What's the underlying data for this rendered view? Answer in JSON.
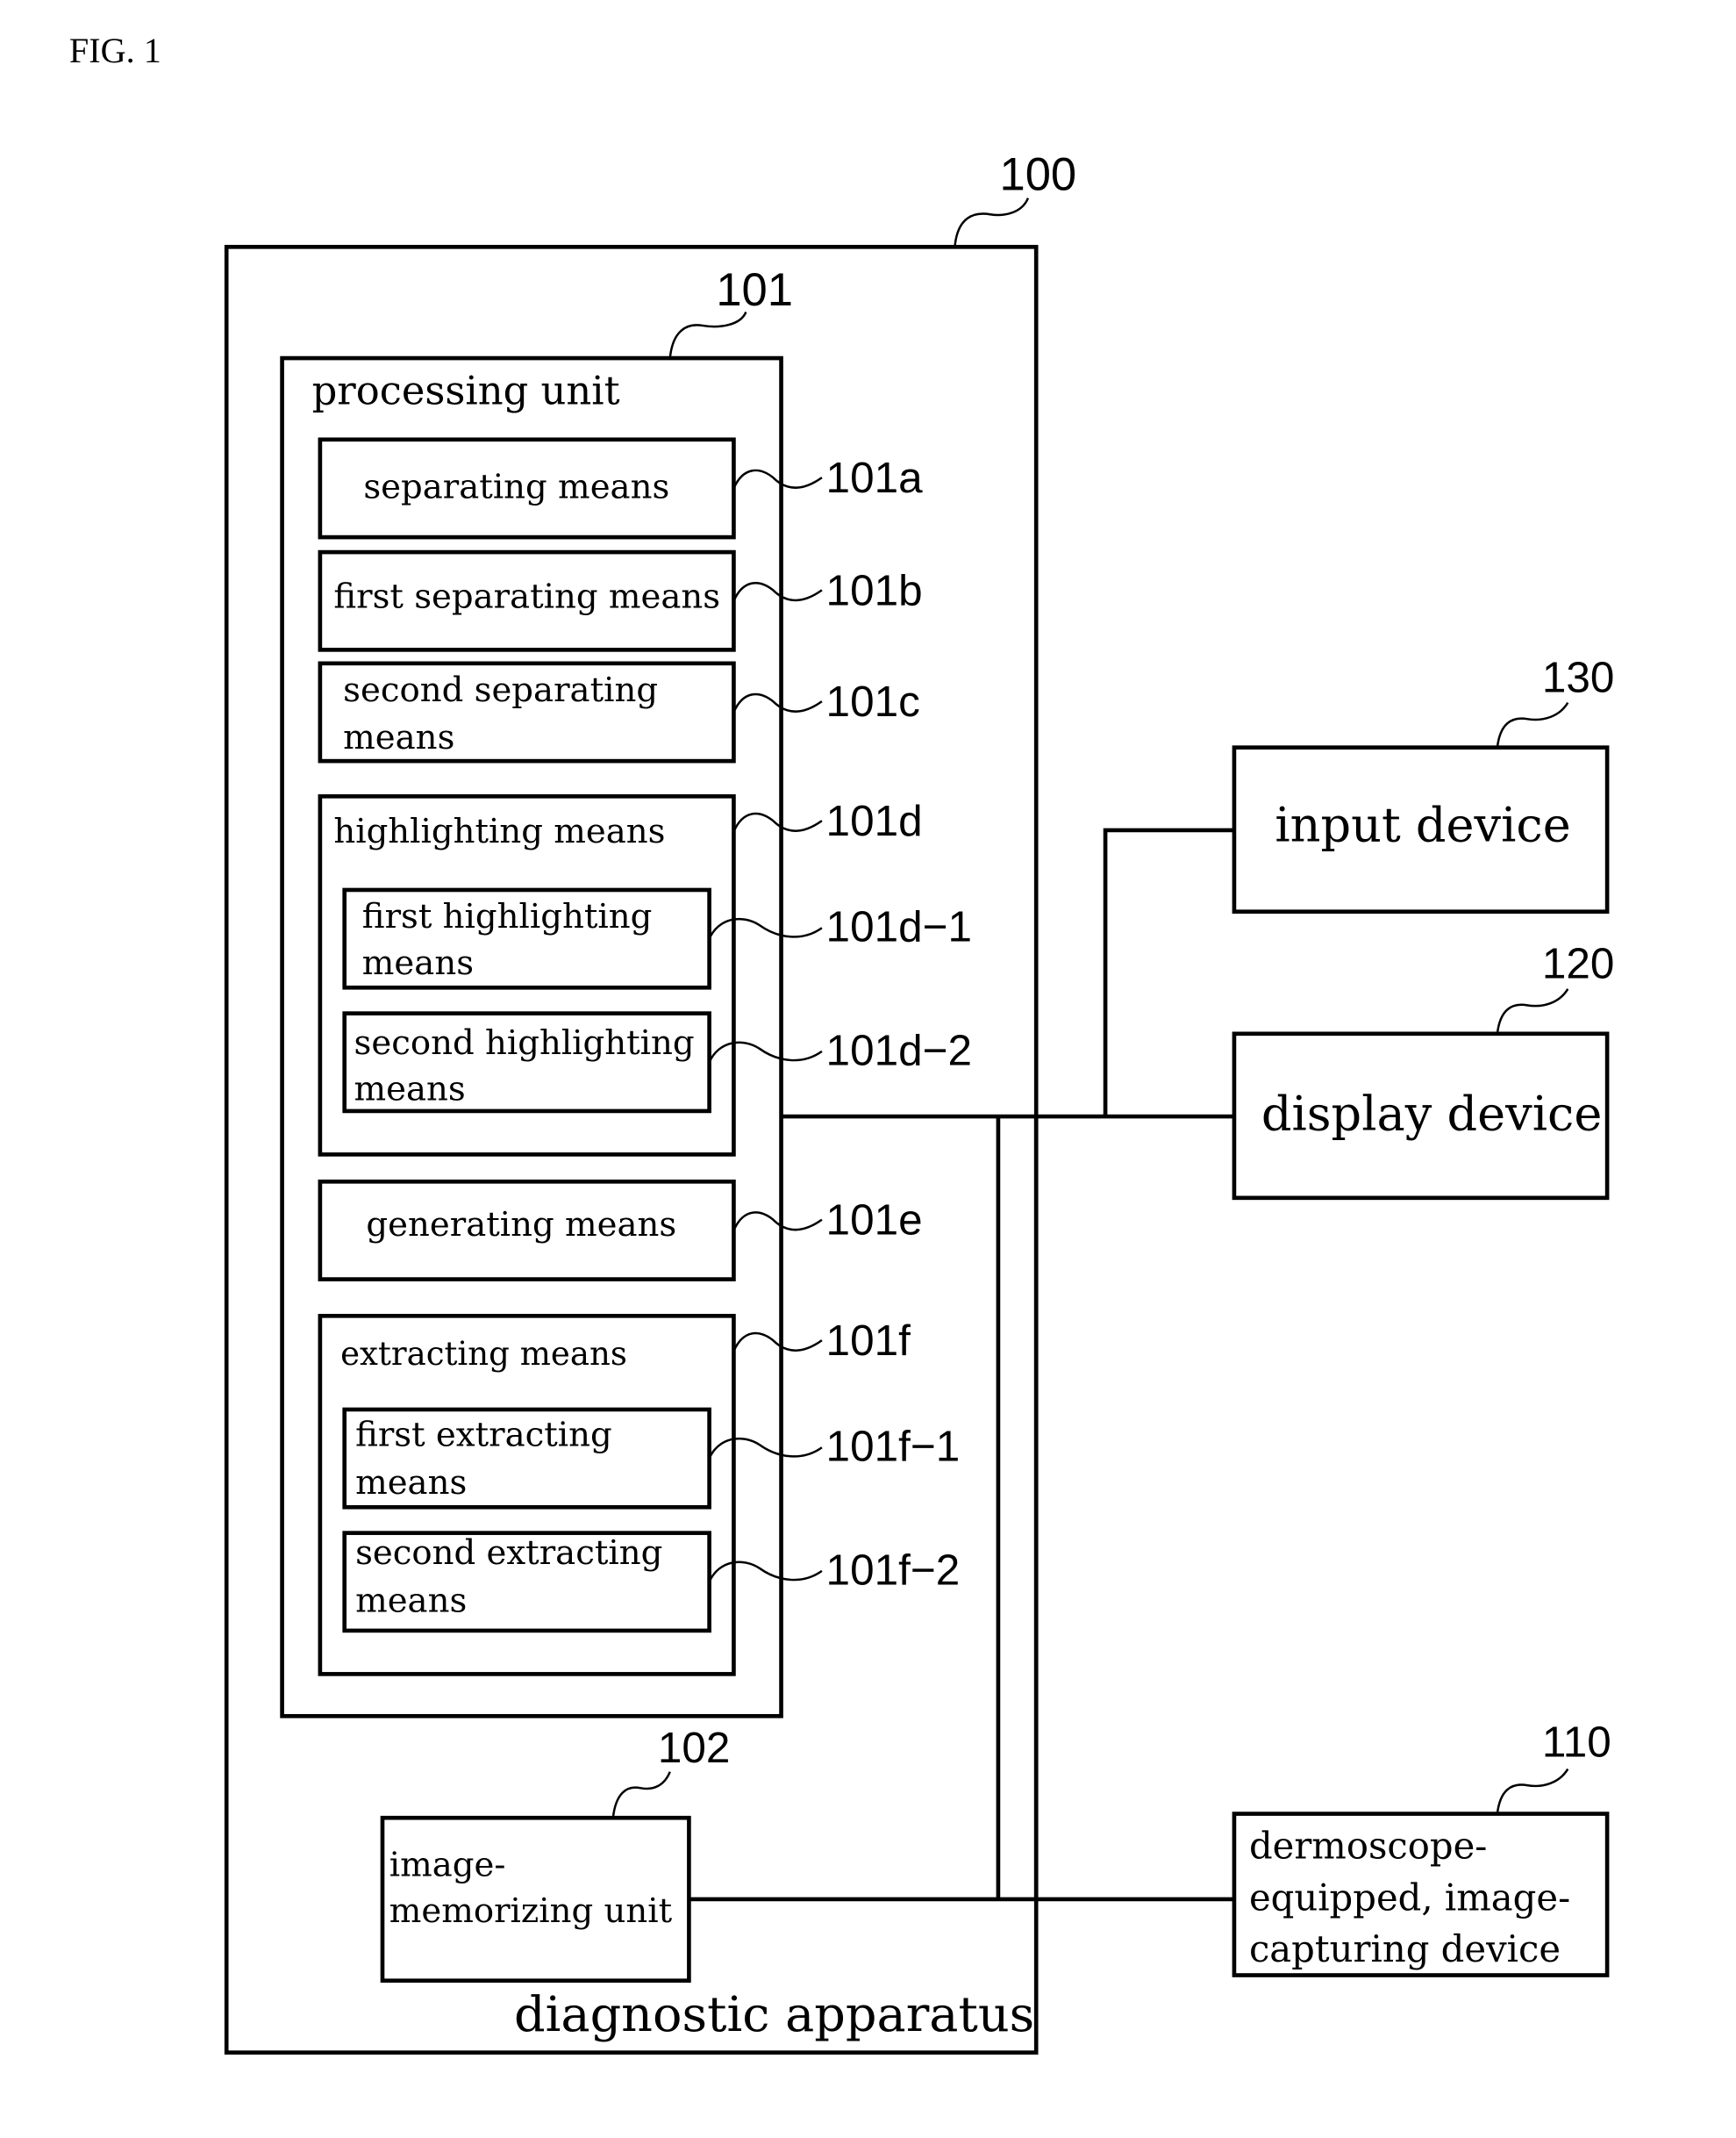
{
  "figure_label": "FIG. 1",
  "apparatus": {
    "ref": "100",
    "label": "diagnostic apparatus",
    "processing_unit": {
      "ref": "101",
      "label": "processing unit",
      "means": [
        {
          "ref": "101a",
          "lines": [
            "separating means"
          ]
        },
        {
          "ref": "101b",
          "lines": [
            "first separating means"
          ]
        },
        {
          "ref": "101c",
          "lines": [
            "second separating",
            "means"
          ]
        },
        {
          "ref": "101d",
          "lines": [
            "highlighting means"
          ],
          "children": [
            {
              "ref": "101d−1",
              "lines": [
                "first highlighting",
                "means"
              ]
            },
            {
              "ref": "101d−2",
              "lines": [
                "second highlighting",
                "means"
              ]
            }
          ]
        },
        {
          "ref": "101e",
          "lines": [
            "generating means"
          ]
        },
        {
          "ref": "101f",
          "lines": [
            "extracting means"
          ],
          "children": [
            {
              "ref": "101f−1",
              "lines": [
                "first extracting",
                "means"
              ]
            },
            {
              "ref": "101f−2",
              "lines": [
                "second extracting",
                "means"
              ]
            }
          ]
        }
      ]
    },
    "memory_unit": {
      "ref": "102",
      "lines": [
        "image-",
        "memorizing unit"
      ]
    }
  },
  "external_devices": {
    "input": {
      "ref": "130",
      "label": "input device"
    },
    "display": {
      "ref": "120",
      "label": "display device"
    },
    "capture": {
      "ref": "110",
      "lines": [
        "dermoscope-",
        "equipped, image-",
        "capturing device"
      ]
    }
  }
}
